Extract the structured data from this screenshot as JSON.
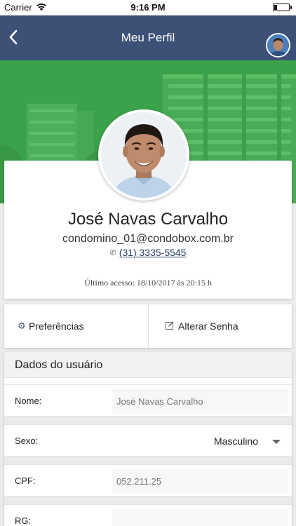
{
  "status_bar": {
    "carrier": "Carrier",
    "time": "9:16 PM"
  },
  "nav": {
    "title": "Meu Perfil"
  },
  "profile": {
    "name": "José Navas Carvalho",
    "email": "condomino_01@condobox.com.br",
    "phone": "(31) 3335-5545",
    "last_access": "Último acesso: 18/10/2017 às 20:15 h"
  },
  "actions": {
    "preferences": "Preferências",
    "change_password": "Alterar Senha"
  },
  "user_data": {
    "title": "Dados do usuário",
    "fields": [
      {
        "label": "Nome:",
        "value": "José Navas Carvalho"
      },
      {
        "label": "Sexo:",
        "value": "Masculino"
      },
      {
        "label": "CPF:",
        "value": "052.211.25"
      },
      {
        "label": "RG:",
        "value": ""
      }
    ]
  },
  "colors": {
    "nav_bar": "#3d5176",
    "hero_green": "#3aa24a",
    "link": "#2b3f6b"
  }
}
